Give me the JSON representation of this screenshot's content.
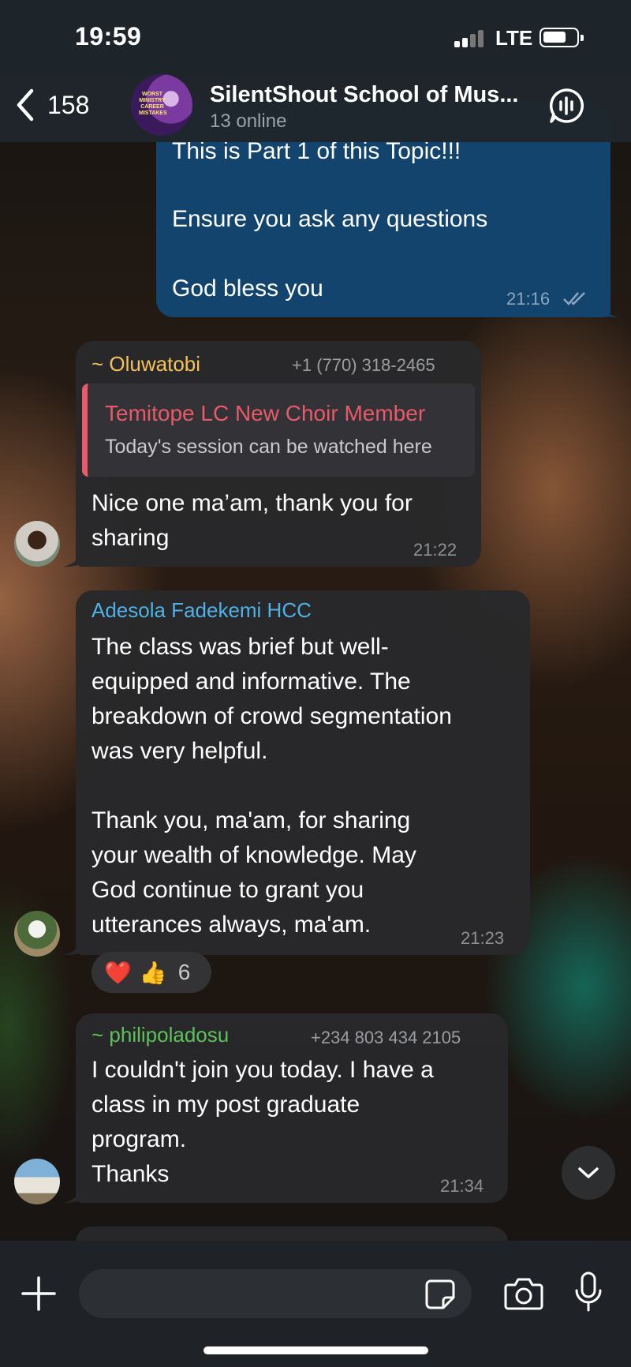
{
  "status_bar": {
    "time": "19:59",
    "network": "LTE"
  },
  "header": {
    "back_count": "158",
    "title": "SilentShout School of Mus...",
    "subtitle": "13 online",
    "avatar_text": "WORST MINISTRY CAREER MISTAKES"
  },
  "messages": [
    {
      "type": "outgoing",
      "text_lines": [
        "This is Part 1 of this Topic!!!",
        "Ensure you ask any questions",
        "God bless you"
      ],
      "time": "21:16"
    },
    {
      "type": "incoming",
      "sender": "~ Oluwatobi",
      "phone": "+1 (770) 318-2465",
      "reply_to": {
        "name": "Temitope LC New Choir Member",
        "text": "Today's session can be watched here"
      },
      "text": "Nice one ma’am, thank you for\nsharing",
      "time": "21:22"
    },
    {
      "type": "incoming",
      "sender": "Adesola Fadekemi HCC",
      "text": "The class was brief but well-\nequipped and informative. The\nbreakdown of crowd segmentation\nwas very helpful.\n\nThank you, ma'am, for sharing\nyour wealth of knowledge. May\nGod continue to grant you\nutterances always, ma'am.",
      "time": "21:23",
      "reactions": {
        "emoji1": "❤️",
        "emoji2": "👍",
        "count": "6"
      }
    },
    {
      "type": "incoming",
      "sender": "~ philipoladosu",
      "phone": "+234 803 434 2105",
      "text": "I couldn't join you today. I have a\nclass in my post graduate\nprogram.\nThanks",
      "time": "21:34"
    }
  ],
  "colors": {
    "outgoing_bubble": "#13446d",
    "incoming_bubble": "#28282a",
    "sender_oluwatobi": "#f3c25b",
    "sender_adesola": "#4fb1e6",
    "sender_philip": "#5cc25b",
    "reply_name": "#e8596a"
  },
  "icons": [
    "back-chevron-icon",
    "voice-chat-icon",
    "scroll-down-icon",
    "attach-plus-icon",
    "sticker-icon",
    "camera-icon",
    "microphone-icon",
    "read-checkmarks-icon"
  ]
}
